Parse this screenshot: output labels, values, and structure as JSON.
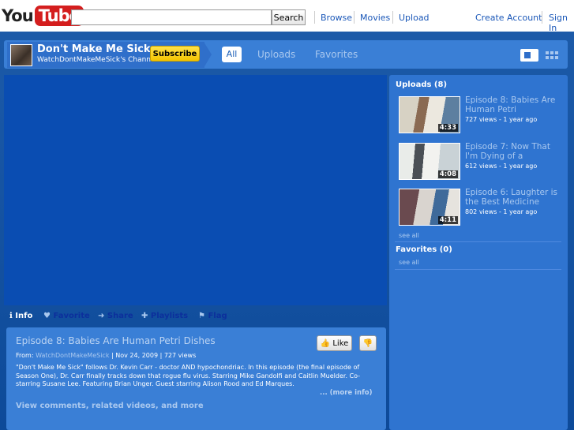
{
  "header": {
    "logo_you": "You",
    "logo_tube": "Tube",
    "search_placeholder": "",
    "search_button": "Search",
    "nav": [
      "Browse",
      "Movies",
      "Upload"
    ],
    "create_account": "Create Account",
    "sign_in": "Sign In"
  },
  "channel": {
    "title": "Don't Make Me Sick",
    "subtitle": "WatchDontMakeMeSick's Channel",
    "subscribe_label": "Subscribe",
    "tabs": [
      "All",
      "Uploads",
      "Favorites"
    ]
  },
  "actions": {
    "info": "Info",
    "favorite": "Favorite",
    "share": "Share",
    "playlists": "Playlists",
    "flag": "Flag"
  },
  "video": {
    "title": "Episode 8: Babies Are Human Petri Dishes",
    "like_label": "Like",
    "from_label": "From:",
    "from_user": "WatchDontMakeMeSick",
    "date": "Nov 24, 2009",
    "views": "727 views",
    "description": "\"Don't Make Me Sick\" follows Dr. Kevin Carr - doctor AND hypochondriac. In this episode (the final episode of Season One), Dr. Carr finally tracks down that rogue flu virus. Starring Mike Gandolfi and Caitlin Muelder. Co-starring Susane Lee. Featuring Brian Unger. Guest starring Alison Rood and Ed Marques.",
    "more_info": "... (more info)",
    "view_comments": "View comments, related videos, and more"
  },
  "sidebar": {
    "uploads_heading": "Uploads (8)",
    "uploads": [
      {
        "title": "Episode 8: Babies Are Human Petri",
        "meta": "727 views - 1 year ago",
        "duration": "4:33"
      },
      {
        "title": "Episode 7: Now That I'm Dying of a",
        "meta": "612 views - 1 year ago",
        "duration": "4:08"
      },
      {
        "title": "Episode 6: Laughter is the Best Medicine",
        "meta": "802 views - 1 year ago",
        "duration": "4:11"
      }
    ],
    "see_all": "see all",
    "favorites_heading": "Favorites (0)",
    "favorites_see_all": "see all"
  },
  "colors": {
    "accent_yellow": "#f4c400",
    "panel_blue": "#3a7fd6",
    "player_blue": "#0a4db2",
    "logo_red": "#d41e1e"
  }
}
